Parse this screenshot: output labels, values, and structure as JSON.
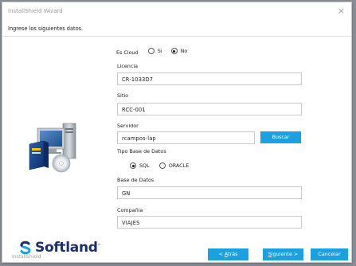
{
  "window": {
    "title": "InstallShield Wizard",
    "close_glyph": "×"
  },
  "header": {
    "instruction": "Ingrese los siguientes datos."
  },
  "es_cloud": {
    "label": "Es Cloud",
    "options": [
      {
        "label": "Si",
        "checked": false
      },
      {
        "label": "No",
        "checked": true
      }
    ]
  },
  "licencia": {
    "label": "Licencia",
    "value": "CR-1033D7"
  },
  "sitio": {
    "label": "Sitio",
    "value": "RCC-001"
  },
  "servidor": {
    "label": "Servidor",
    "value": "rcampos-lap",
    "button": "Buscar"
  },
  "tipo_base": {
    "label": "Tipo Base de Datos",
    "options": [
      {
        "label": "SQL",
        "checked": true
      },
      {
        "label": "ORACLE",
        "checked": false
      }
    ]
  },
  "base_datos": {
    "label": "Base de Datos",
    "value": "GN"
  },
  "compania": {
    "label": "Compañia",
    "value": "VIAJES"
  },
  "footer": {
    "back": {
      "prefix": "< ",
      "accel": "A",
      "rest": "trás"
    },
    "next": {
      "accel": "S",
      "rest": "iguiente >"
    },
    "cancel": "Cancelar",
    "brand": "Softland",
    "brand_tm": "™",
    "installshield": "InstallShield"
  },
  "colors": {
    "accent": "#1ba1e2",
    "brand": "#1a2f6b"
  },
  "icons": {
    "illustration": "computer-setup-icon",
    "logo": "softland-logo-icon"
  }
}
